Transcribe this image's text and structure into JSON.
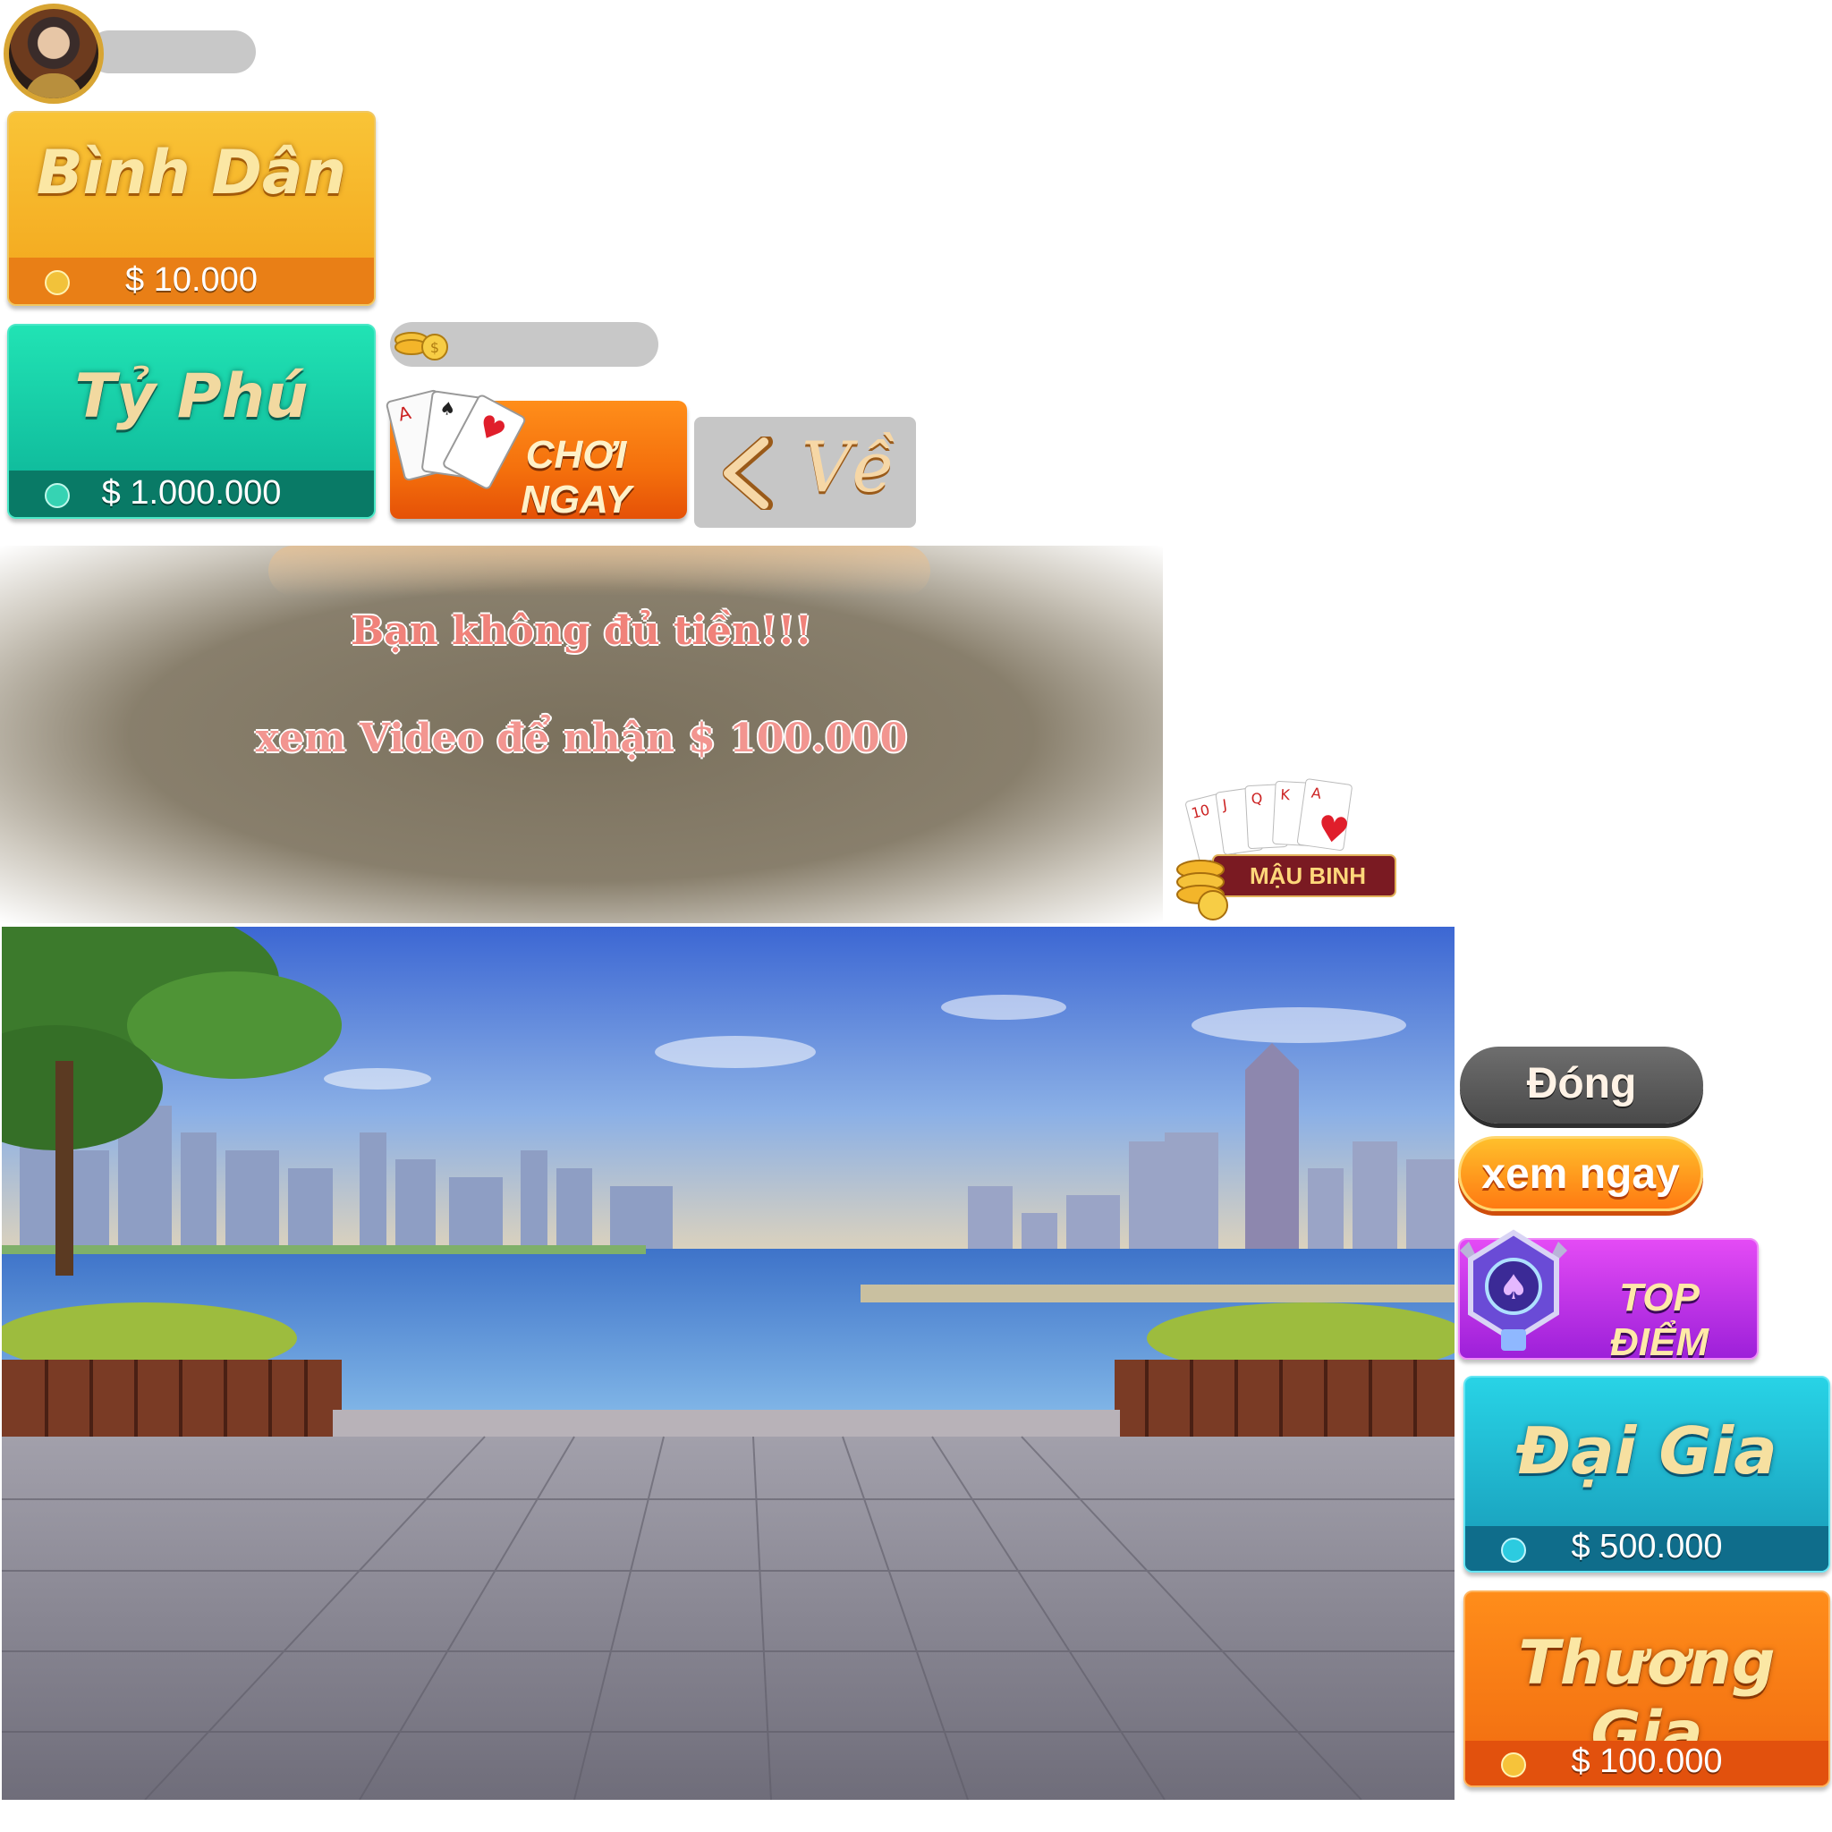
{
  "player": {
    "avatar_icon": "player-avatar-icon"
  },
  "rooms": [
    {
      "id": "binh-dan",
      "name": "Bình Dân",
      "price": "$ 10.000",
      "color": "#f5b021"
    },
    {
      "id": "ty-phu",
      "name": "Tỷ Phú",
      "price": "$ 1.000.000",
      "color": "#14c9a5"
    },
    {
      "id": "dai-gia",
      "name": "Đại Gia",
      "price": "$ 500.000",
      "color": "#1fb3cf"
    },
    {
      "id": "thuong-gia",
      "name": "Thương Gia",
      "price": "$ 100.000",
      "color": "#f27814"
    }
  ],
  "buttons": {
    "play_now": "CHƠI NGAY",
    "back": "Về",
    "close": "Đóng",
    "watch_now": "xem ngay",
    "top_score": "TOP ĐIỂM"
  },
  "popup": {
    "line1": "Bạn không đủ tiền!!!",
    "line2": "xem Video để nhận $ 100.000"
  },
  "logo": {
    "text": "MẬU BINH",
    "cards": [
      "10",
      "J",
      "Q",
      "K",
      "A"
    ]
  },
  "icons": [
    "coin-icon",
    "coins-stack-icon",
    "playing-cards-icon",
    "chevron-left-icon",
    "trophy-badge-icon",
    "spade-icon"
  ]
}
